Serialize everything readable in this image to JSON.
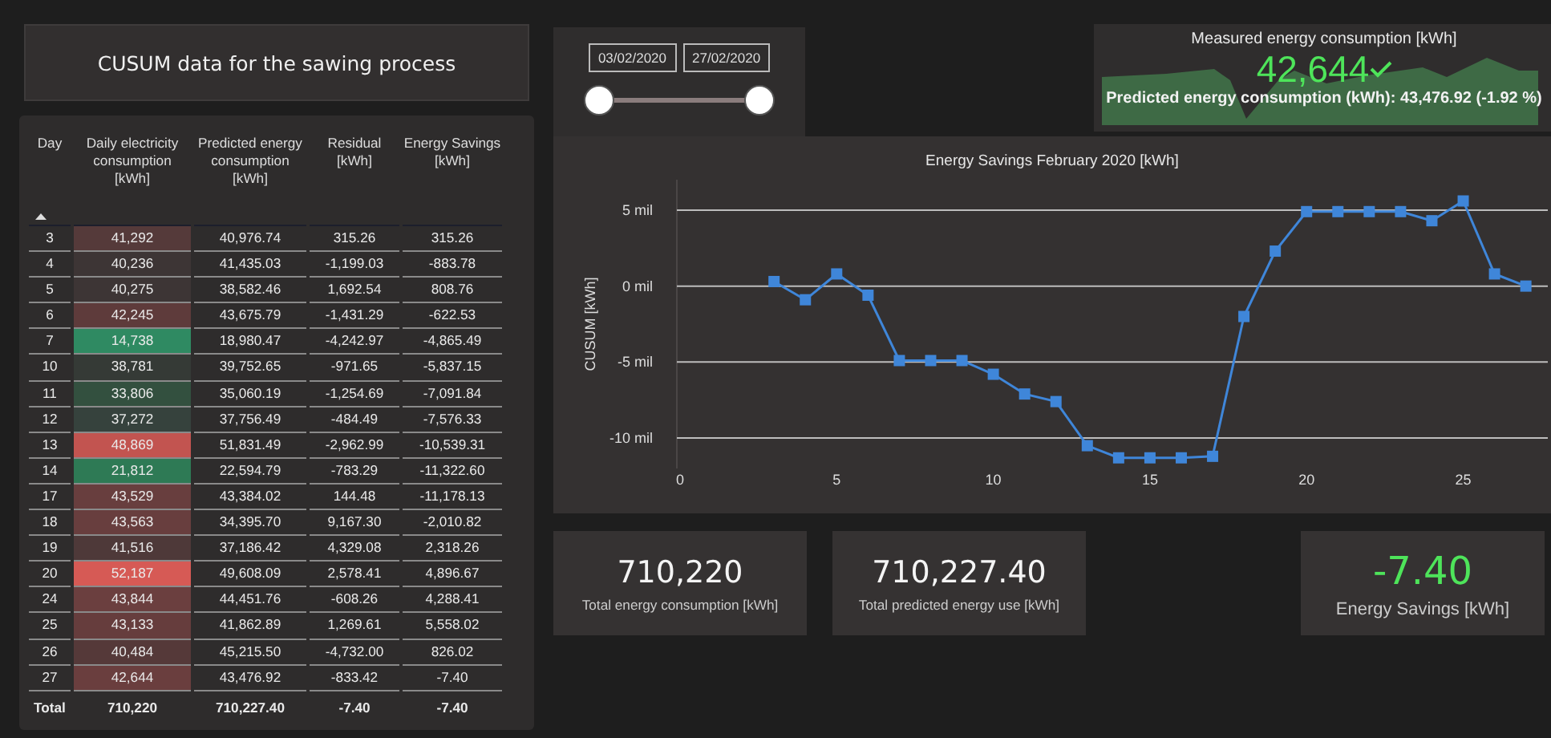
{
  "title": "CUSUM data for the sawing process",
  "table": {
    "columns": [
      {
        "label": "Day",
        "sorted": true
      },
      {
        "label": "Daily electricity consumption [kWh]"
      },
      {
        "label": "Predicted energy consumption [kWh]"
      },
      {
        "label": "Residual [kWh]"
      },
      {
        "label": "Energy Savings [kWh]"
      }
    ],
    "rows": [
      {
        "day": "3",
        "consumption": "41,292",
        "color": "#553a3a",
        "predicted": "40,976.74",
        "residual": "315.26",
        "savings": "315.26"
      },
      {
        "day": "4",
        "consumption": "40,236",
        "color": "#3d3535",
        "predicted": "41,435.03",
        "residual": "-1,199.03",
        "savings": "-883.78"
      },
      {
        "day": "5",
        "consumption": "40,275",
        "color": "#3d3535",
        "predicted": "38,582.46",
        "residual": "1,692.54",
        "savings": "808.76"
      },
      {
        "day": "6",
        "consumption": "42,245",
        "color": "#5e3b3b",
        "predicted": "43,675.79",
        "residual": "-1,431.29",
        "savings": "-622.53"
      },
      {
        "day": "7",
        "consumption": "14,738",
        "color": "#2f8a62",
        "predicted": "18,980.47",
        "residual": "-4,242.97",
        "savings": "-4,865.49"
      },
      {
        "day": "10",
        "consumption": "38,781",
        "color": "#353a36",
        "predicted": "39,752.65",
        "residual": "-971.65",
        "savings": "-5,837.15"
      },
      {
        "day": "11",
        "consumption": "33,806",
        "color": "#33503f",
        "predicted": "35,060.19",
        "residual": "-1,254.69",
        "savings": "-7,091.84"
      },
      {
        "day": "12",
        "consumption": "37,272",
        "color": "#36423d",
        "predicted": "37,756.49",
        "residual": "-484.49",
        "savings": "-7,576.33"
      },
      {
        "day": "13",
        "consumption": "48,869",
        "color": "#c25450",
        "predicted": "51,831.49",
        "residual": "-2,962.99",
        "savings": "-10,539.31"
      },
      {
        "day": "14",
        "consumption": "21,812",
        "color": "#2e7a55",
        "predicted": "22,594.79",
        "residual": "-783.29",
        "savings": "-11,322.60"
      },
      {
        "day": "17",
        "consumption": "43,529",
        "color": "#683e3e",
        "predicted": "43,384.02",
        "residual": "144.48",
        "savings": "-11,178.13"
      },
      {
        "day": "18",
        "consumption": "43,563",
        "color": "#683e3e",
        "predicted": "34,395.70",
        "residual": "9,167.30",
        "savings": "-2,010.82"
      },
      {
        "day": "19",
        "consumption": "41,516",
        "color": "#4e3939",
        "predicted": "37,186.42",
        "residual": "4,329.08",
        "savings": "2,318.26"
      },
      {
        "day": "20",
        "consumption": "52,187",
        "color": "#d65a55",
        "predicted": "49,608.09",
        "residual": "2,578.41",
        "savings": "4,896.67"
      },
      {
        "day": "24",
        "consumption": "43,844",
        "color": "#6b3f3f",
        "predicted": "44,451.76",
        "residual": "-608.26",
        "savings": "4,288.41"
      },
      {
        "day": "25",
        "consumption": "43,133",
        "color": "#663d3d",
        "predicted": "41,862.89",
        "residual": "1,269.61",
        "savings": "5,558.02"
      },
      {
        "day": "26",
        "consumption": "40,484",
        "color": "#553939",
        "predicted": "45,215.50",
        "residual": "-4,732.00",
        "savings": "826.02"
      },
      {
        "day": "27",
        "consumption": "42,644",
        "color": "#6a3e3e",
        "predicted": "43,476.92",
        "residual": "-833.42",
        "savings": "-7.40"
      }
    ],
    "total": {
      "label": "Total",
      "consumption": "710,220",
      "predicted": "710,227.40",
      "residual": "-7.40",
      "savings": "-7.40"
    }
  },
  "date_slicer": {
    "start": "03/02/2020",
    "end": "27/02/2020",
    "handles": [
      {
        "level": 0
      },
      {
        "level": 1
      }
    ]
  },
  "kpi": {
    "title": "Measured energy consumption [kWh]",
    "value": "42,644",
    "target_met": true,
    "subtitle": "Predicted energy consumption (kWh): 43,476.92 (-1.92 %)"
  },
  "chart": {
    "chart_data": {
      "type": "line",
      "title": "Energy Savings February 2020 [kWh]",
      "ylabel": "CUSUM [kWh]",
      "x": [
        3,
        4,
        5,
        6,
        7,
        8,
        9,
        10,
        11,
        12,
        13,
        14,
        15,
        16,
        17,
        18,
        19,
        20,
        21,
        22,
        23,
        24,
        25,
        26,
        27
      ],
      "grid": true,
      "series": [
        {
          "color": "#3f86d9",
          "marker": "square",
          "values": [
            0.3,
            -0.9,
            0.8,
            -0.6,
            -4.9,
            -4.9,
            -4.9,
            -5.8,
            -7.1,
            -7.6,
            -10.5,
            -11.3,
            -11.3,
            -11.3,
            -11.2,
            -2.0,
            2.3,
            4.9,
            4.9,
            4.9,
            4.9,
            4.3,
            5.6,
            0.8,
            0.0
          ]
        }
      ],
      "xlim": [
        0,
        27.7
      ],
      "ylim": [
        -12,
        7
      ],
      "xticks": [
        0,
        5,
        10,
        15,
        20,
        25
      ],
      "yticks": [
        {
          "value": 5,
          "label": "5 mil"
        },
        {
          "value": 0,
          "label": "0 mil"
        },
        {
          "value": -5,
          "label": "-5 mil"
        },
        {
          "value": -10,
          "label": "-10 mil"
        }
      ]
    }
  },
  "cards": [
    {
      "kind": "plain",
      "value": "710,220",
      "label": "Total energy consumption [kWh]"
    },
    {
      "kind": "plain",
      "value": "710,227.40",
      "label": "Total predicted energy use [kWh]"
    },
    {
      "kind": "highlight",
      "value": "-7.40",
      "label": "Energy Savings [kWh]"
    }
  ]
}
